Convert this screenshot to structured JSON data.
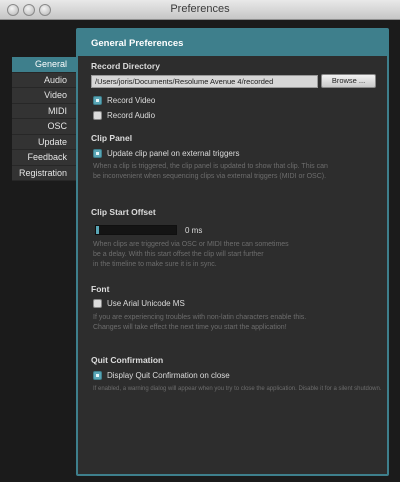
{
  "window": {
    "title": "Preferences"
  },
  "sidebar": {
    "items": [
      {
        "label": "General",
        "active": true
      },
      {
        "label": "Audio"
      },
      {
        "label": "Video"
      },
      {
        "label": "MIDI"
      },
      {
        "label": "OSC"
      },
      {
        "label": "Update"
      },
      {
        "label": "Feedback"
      },
      {
        "label": "Registration"
      }
    ]
  },
  "panel": {
    "title": "General Preferences",
    "record": {
      "title": "Record Directory",
      "path": "/Users/joris/Documents/Resolume Avenue 4/recorded",
      "browse_label": "Browse ...",
      "record_video": {
        "label": "Record Video",
        "checked": true
      },
      "record_audio": {
        "label": "Record Audio",
        "checked": false
      }
    },
    "clip_panel": {
      "title": "Clip Panel",
      "option": {
        "label": "Update clip panel on external triggers",
        "checked": true
      },
      "help_1": "When a clip is triggered, the clip panel is updated to show that clip. This can",
      "help_2": "be inconvenient when sequencing clips via external triggers (MIDI or OSC)."
    },
    "clip_offset": {
      "title": "Clip Start Offset",
      "value_label": "0 ms",
      "value": 0,
      "help_1": "When clips are triggered via OSC or MIDI there can sometimes",
      "help_2": "be a delay. With this start offset the clip will start further",
      "help_3": "in the timeline to make sure it is in sync."
    },
    "font": {
      "title": "Font",
      "option": {
        "label": "Use Arial Unicode MS",
        "checked": false
      },
      "help_1": "If you are experiencing troubles with non-latin characters enable this.",
      "help_2": "Changes will take effect the next time you start the application!"
    },
    "quit": {
      "title": "Quit Confirmation",
      "option": {
        "label": "Display Quit Confirmation on close",
        "checked": true
      },
      "help_1": "If enabled, a warning dialog will appear when you try to close the application. Disable it for a silent shutdown."
    }
  },
  "colors": {
    "accent": "#3e7f8c",
    "background": "#1b1b1b",
    "panel": "#2d2d2d"
  }
}
